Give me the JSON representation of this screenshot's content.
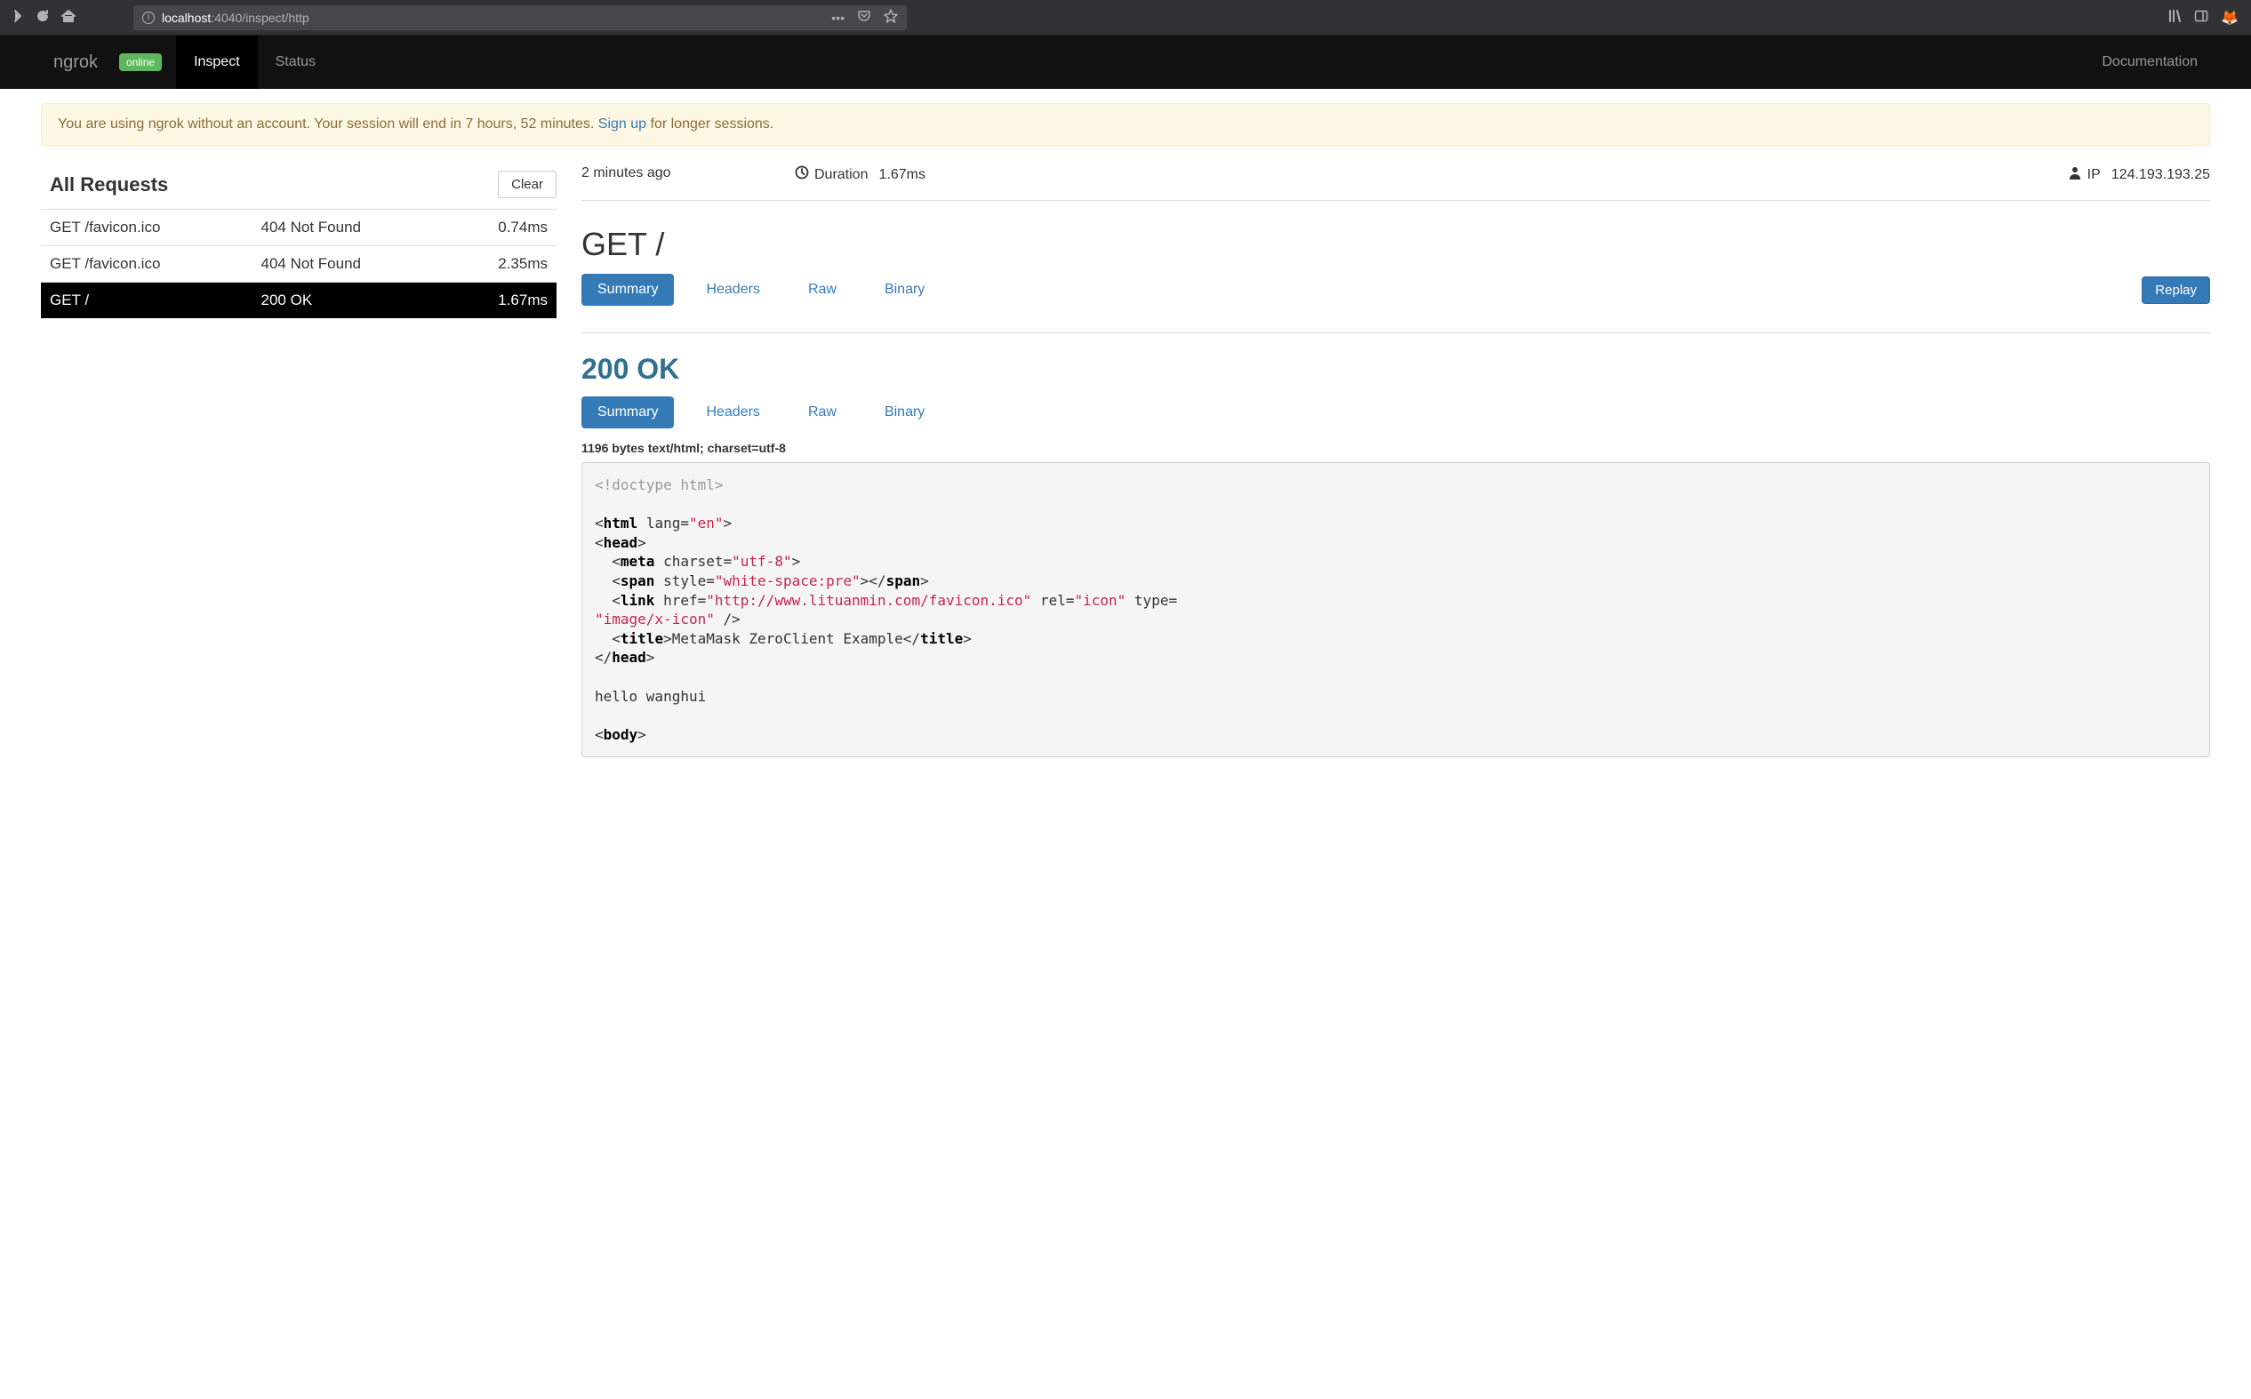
{
  "chrome": {
    "url_host": "localhost",
    "url_rest": ":4040/inspect/http"
  },
  "navbar": {
    "brand": "ngrok",
    "badge": "online",
    "tabs": [
      "Inspect",
      "Status"
    ],
    "active_tab": "Inspect",
    "doc_link": "Documentation"
  },
  "alert": {
    "prefix": "You are using ngrok without an account. Your session will end in 7 hours, 52 minutes. ",
    "link": "Sign up",
    "suffix": " for longer sessions."
  },
  "all_requests": {
    "title": "All Requests",
    "clear": "Clear",
    "rows": [
      {
        "req": "GET /favicon.ico",
        "status": "404 Not Found",
        "time": "0.74ms",
        "selected": false
      },
      {
        "req": "GET /favicon.ico",
        "status": "404 Not Found",
        "time": "2.35ms",
        "selected": false
      },
      {
        "req": "GET /",
        "status": "200 OK",
        "time": "1.67ms",
        "selected": true
      }
    ]
  },
  "detail": {
    "meta": {
      "age": "2 minutes ago",
      "duration_label": "Duration",
      "duration_value": "1.67ms",
      "ip_label": "IP",
      "ip_value": "124.193.193.25"
    },
    "request_line": "GET /",
    "req_tabs": [
      "Summary",
      "Headers",
      "Raw",
      "Binary"
    ],
    "replay": "Replay",
    "status_line": "200 OK",
    "resp_tabs": [
      "Summary",
      "Headers",
      "Raw",
      "Binary"
    ],
    "bytes_line": "1196 bytes text/html; charset=utf-8",
    "code": {
      "doctype": "<!doctype html>",
      "lines": [
        {
          "t": "open",
          "tag": "html",
          "attrs": [
            {
              "n": "lang",
              "v": "\"en\""
            }
          ],
          "selfclose": false
        },
        {
          "t": "open",
          "tag": "head",
          "attrs": [],
          "selfclose": false
        },
        {
          "t": "indent-open",
          "tag": "meta",
          "attrs": [
            {
              "n": "charset",
              "v": "\"utf-8\""
            }
          ],
          "selfclose": false
        },
        {
          "t": "indent-open-close",
          "tag": "span",
          "attrs": [
            {
              "n": "style",
              "v": "\"white-space:pre\""
            }
          ]
        },
        {
          "t": "indent-open",
          "tag": "link",
          "attrs": [
            {
              "n": "href",
              "v": "\"http://www.lituanmin.com/favicon.ico\""
            },
            {
              "n": "rel",
              "v": "\"icon\""
            },
            {
              "n": "type",
              "v": ""
            }
          ],
          "wrapvalue": "\"image/x-icon\"",
          "selfclose": true
        },
        {
          "t": "indent-open-text-close",
          "tag": "title",
          "text": "MetaMask ZeroClient Example"
        },
        {
          "t": "close",
          "tag": "head"
        },
        {
          "t": "blank"
        },
        {
          "t": "text",
          "text": "hello wanghui"
        },
        {
          "t": "blank"
        },
        {
          "t": "open",
          "tag": "body",
          "attrs": [],
          "selfclose": false
        }
      ]
    }
  }
}
